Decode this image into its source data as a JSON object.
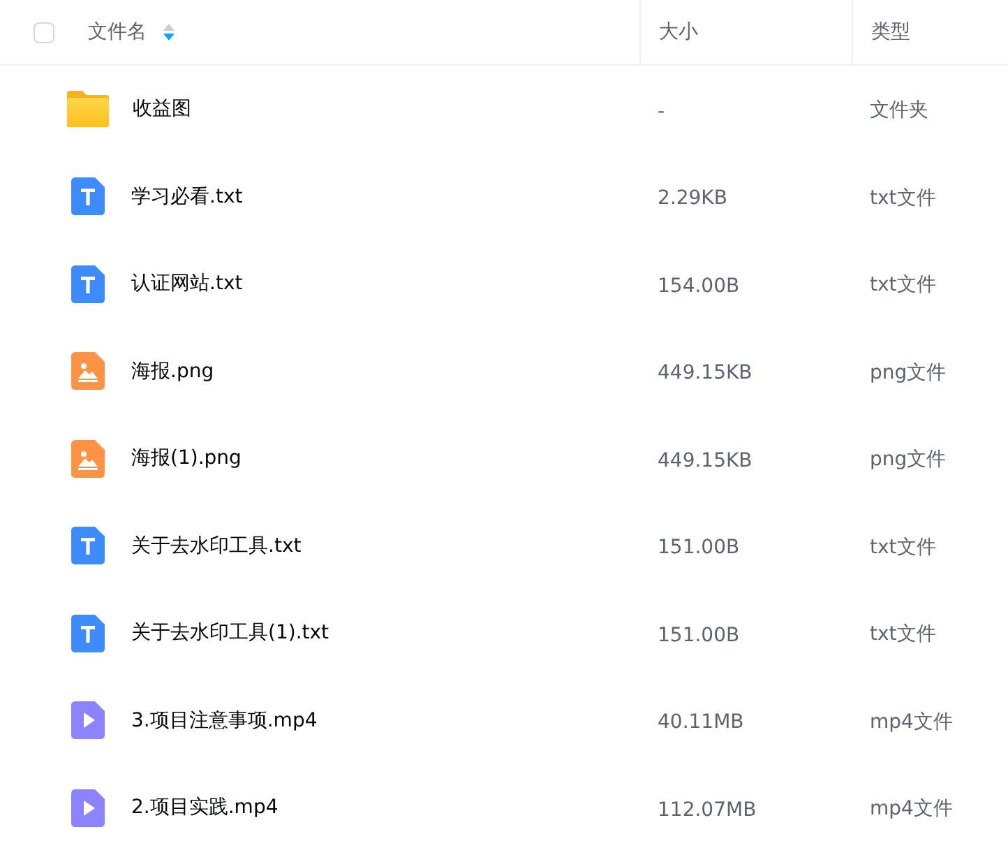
{
  "header": {
    "select_all": {
      "checked": false
    },
    "columns": [
      {
        "label": "文件名",
        "sorted_descending": true
      },
      {
        "label": "大小"
      },
      {
        "label": "类型"
      }
    ]
  },
  "rows": [
    {
      "kind": "folder",
      "name": "收益图",
      "size": "-",
      "type": "文件夹"
    },
    {
      "kind": "text",
      "name": "学习必看.txt",
      "size": "2.29KB",
      "type": "txt文件"
    },
    {
      "kind": "text",
      "name": "认证网站.txt",
      "size": "154.00B",
      "type": "txt文件"
    },
    {
      "kind": "image",
      "name": "海报.png",
      "size": "449.15KB",
      "type": "png文件"
    },
    {
      "kind": "image",
      "name": "海报(1).png",
      "size": "449.15KB",
      "type": "png文件"
    },
    {
      "kind": "text",
      "name": "关于去水印工具.txt",
      "size": "151.00B",
      "type": "txt文件"
    },
    {
      "kind": "text",
      "name": "关于去水印工具(1).txt",
      "size": "151.00B",
      "type": "txt文件"
    },
    {
      "kind": "video",
      "name": "3.项目注意事项.mp4",
      "size": "40.11MB",
      "type": "mp4文件"
    },
    {
      "kind": "video",
      "name": "2.项目实践.mp4",
      "size": "112.07MB",
      "type": "mp4文件"
    }
  ]
}
